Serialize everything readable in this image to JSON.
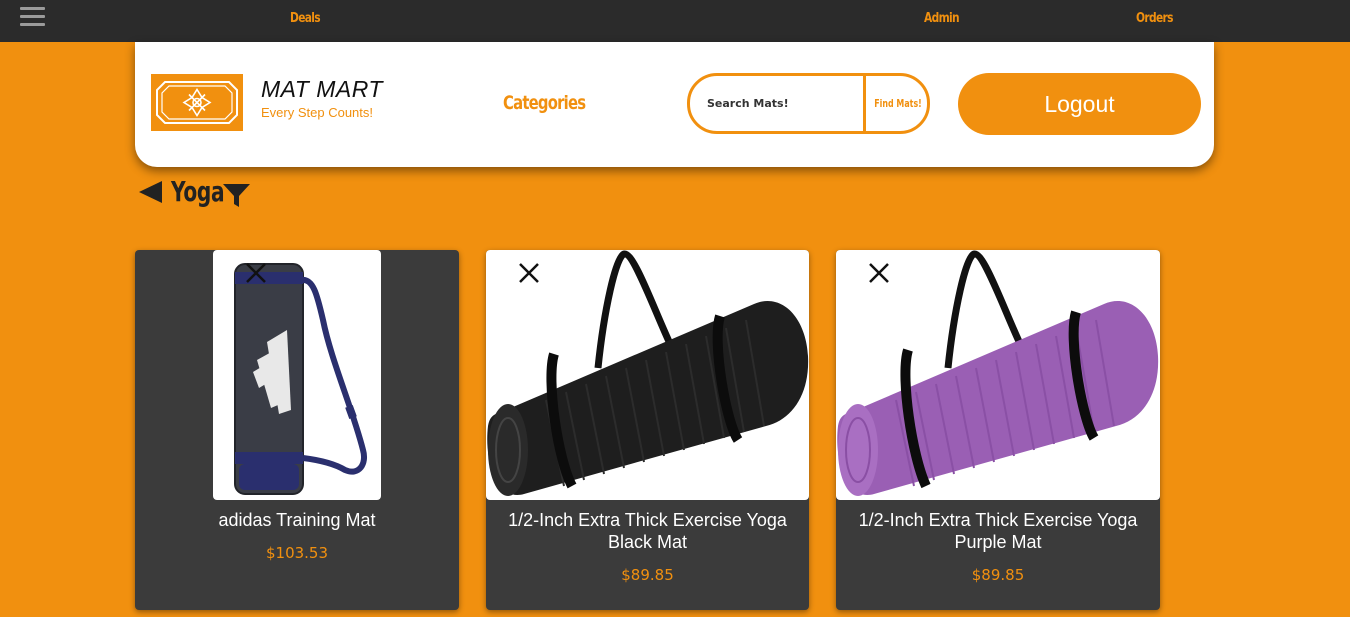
{
  "nav": {
    "menu_icon": "hamburger-icon",
    "links": [
      {
        "label": "Deals"
      },
      {
        "label": "Admin"
      },
      {
        "label": "Orders"
      }
    ]
  },
  "header": {
    "logo_icon": "ornament-logo-icon",
    "brand_title": "MAT MART",
    "brand_tagline": "Every Step Counts!",
    "categories_label": "Categories",
    "search": {
      "placeholder": "Search Mats!",
      "button_label": "Find Mats!"
    },
    "logout_label": "Logout"
  },
  "category": {
    "title": "Yoga",
    "back_icon": "back-arrow-icon",
    "filter_icon": "filter-icon"
  },
  "products": [
    {
      "name": "adidas Training Mat",
      "price": "$103.53",
      "image": "rolled-mat-bag-navy",
      "remove_icon": "close-x-icon"
    },
    {
      "name": "1/2-Inch Extra Thick Exercise Yoga Black Mat",
      "price": "$89.85",
      "image": "rolled-mat-black",
      "remove_icon": "close-x-icon"
    },
    {
      "name": "1/2-Inch Extra Thick Exercise Yoga Purple Mat",
      "price": "$89.85",
      "image": "rolled-mat-purple",
      "remove_icon": "close-x-icon"
    }
  ],
  "colors": {
    "accent": "#f1900f",
    "nav_bg": "#2b2b2b",
    "card_bg": "#3b3b3b",
    "black_mat": "#1e1e1e",
    "purple_mat": "#9a5fb4"
  }
}
